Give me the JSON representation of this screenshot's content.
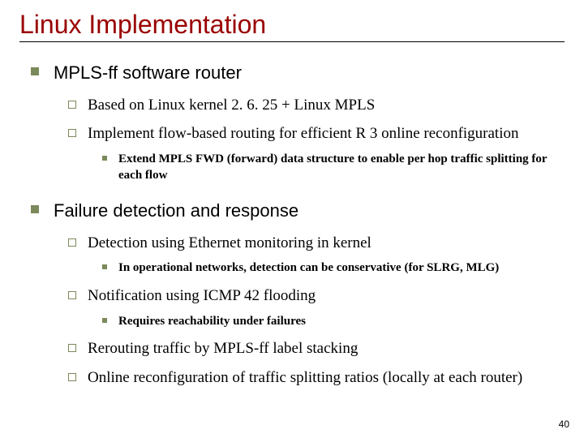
{
  "title": "Linux Implementation",
  "page_number": "40",
  "bullets": [
    {
      "text": "MPLS-ff software router",
      "children": [
        {
          "text": "Based on Linux kernel 2. 6. 25 + Linux MPLS"
        },
        {
          "text": "Implement flow-based routing for efficient R 3 online reconfiguration",
          "children": [
            {
              "text": "Extend MPLS FWD (forward) data structure to enable per hop traffic splitting for each flow"
            }
          ]
        }
      ]
    },
    {
      "text": "Failure detection and response",
      "children": [
        {
          "text": "Detection using Ethernet monitoring in kernel",
          "children": [
            {
              "text": "In operational networks, detection can be conservative (for SLRG, MLG)"
            }
          ]
        },
        {
          "text": "Notification using ICMP 42 flooding",
          "children": [
            {
              "text": "Requires reachability under failures"
            }
          ]
        },
        {
          "text": "Rerouting traffic by MPLS-ff label stacking"
        },
        {
          "text": "Online reconfiguration of traffic splitting ratios (locally at each router)"
        }
      ]
    }
  ]
}
